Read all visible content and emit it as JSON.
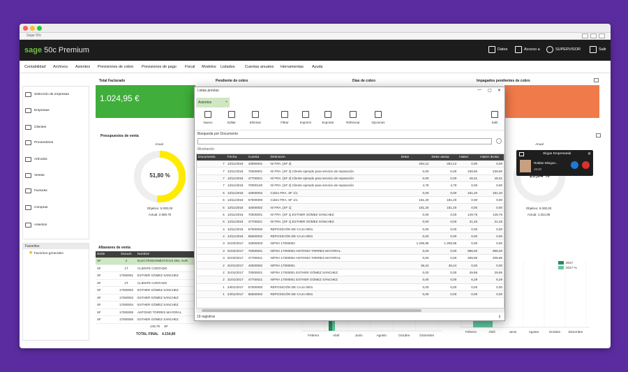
{
  "window": {
    "title": "Sage 50c"
  },
  "header": {
    "brand": "sage",
    "product": "50c Premium",
    "items": [
      {
        "icon": "database-icon",
        "label": "Datos"
      },
      {
        "icon": "access-icon",
        "label": "Acceso a"
      },
      {
        "icon": "user-icon",
        "label": "SUPERVISOR"
      },
      {
        "icon": "exit-icon",
        "label": "Salir"
      }
    ]
  },
  "menu": [
    "Contabilidad",
    "Archivos",
    "Asientos",
    "Previsiones de cobro",
    "Previsiones de pago",
    "Fiscal",
    "Modelos",
    "Listados",
    "Cuentas anuales",
    "Herramientas",
    "Ayuda"
  ],
  "sidebar": {
    "items": [
      {
        "label": "Selección de empresas",
        "icon": "company-select-icon"
      },
      {
        "label": "Empresas",
        "icon": "building-icon"
      },
      {
        "label": "Clientes",
        "icon": "clients-icon"
      },
      {
        "label": "Proveedores",
        "icon": "suppliers-icon"
      },
      {
        "label": "Artículos",
        "icon": "box-icon"
      },
      {
        "label": "Ventas",
        "icon": "sales-icon"
      },
      {
        "label": "Facturas",
        "icon": "invoice-icon"
      },
      {
        "label": "Compras",
        "icon": "cart-icon"
      },
      {
        "label": "Asientos",
        "icon": "ledger-icon"
      }
    ]
  },
  "favorites": {
    "title": "Favoritos",
    "items": [
      "Favoritos generales"
    ]
  },
  "kpis": [
    {
      "label": "Total Facturado",
      "value": "1.024,95 €",
      "color": "#3fae3a"
    },
    {
      "label": "Pendiente de cobro",
      "value": ""
    },
    {
      "label": "Días de cobro",
      "value": ""
    },
    {
      "label": "Impagados pendientes de cobro",
      "value": "",
      "color": "#f07a4a"
    }
  ],
  "presupuestos": {
    "title": "Presupuestos de venta",
    "left": {
      "period": "Anual",
      "percent": "51,80 %",
      "fraction": 0.518,
      "objetivo": "Objetivo: 5.000,00",
      "actual": "Actual: 2.589,75",
      "color": "#ffeb00"
    },
    "right": {
      "period": "Anual",
      "percent": "19,34 %",
      "fraction": 0.1934,
      "objetivo": "Objetivo: 5.000,00",
      "actual": "Actual: 1.024,95"
    }
  },
  "albaranes": {
    "title": "Albaranes de venta",
    "columns": [
      "Serie",
      "Docum",
      "Nombre"
    ],
    "rows": [
      [
        "SF",
        "2",
        "ELECTRODOMÉSTICOS DEL SUR"
      ],
      [
        "SF",
        "1T",
        "CLIENTE CONTADO"
      ],
      [
        "SF",
        "17000001",
        "ESTHER GÓMEZ SÁNCHEZ"
      ],
      [
        "SF",
        "2T",
        "CLIENTE CONTADO"
      ],
      [
        "SF",
        "17000002",
        "ESTHER GÓMEZ SÁNCHEZ"
      ],
      [
        "SF",
        "17000003",
        "ESTHER GÓMEZ SÁNCHEZ"
      ],
      [
        "SF",
        "17000004",
        "ESTHER GÓMEZ SÁNCHEZ"
      ],
      [
        "SF",
        "17000005",
        "ANTONIO TORRES MAYORAL"
      ],
      [
        "SF",
        "17000006",
        "ESTHER GÓMEZ SÁNCHEZ"
      ]
    ],
    "last_amount": "149,75",
    "last_currency": "SF",
    "total_label": "TOTAL FINAL",
    "total_value": "4.154,80"
  },
  "modal": {
    "title": "Listas previas",
    "selector": "Asientos",
    "toolbar": [
      "Nuevo",
      "Editar",
      "Eliminar",
      "Filtrar",
      "Imprimir",
      "Exportar",
      "Refrescar",
      "Opciones",
      "Salir"
    ],
    "search_label": "Búsqueda por Documento",
    "mostrando": "Mostrando:",
    "columns": [
      "Documento",
      "Fecha",
      "Cuenta",
      "Definición",
      "Debe",
      "Debe divisa",
      "Haber",
      "Haber divisa"
    ],
    "rows": [
      [
        "7",
        "13/11/2018",
        "43000001",
        "N/ FRA. [SF     2]",
        "284,12",
        "284,12",
        "0,00",
        "0,00"
      ],
      [
        "7",
        "13/11/2018",
        "70000001",
        "N/ FRA. [SF     2] Cliente ejemplo para servicio de reparación",
        "0,00",
        "0,00",
        "239,60",
        "239,60"
      ],
      [
        "7",
        "13/11/2018",
        "47700021",
        "N/ FRA. [SF     2] Cliente ejemplo para servicio de reparación",
        "0,00",
        "0,00",
        "49,31",
        "49,31"
      ],
      [
        "7",
        "13/11/2018",
        "70000100",
        "N/ FRA. [SF     2] Cliente ejemplo para servicio de reparación",
        "4,79",
        "4,79",
        "0,00",
        "0,00"
      ],
      [
        "6",
        "13/11/2018",
        "43000002",
        "Cobro FRA. SF     1/1",
        "0,00",
        "0,00",
        "181,20",
        "181,20"
      ],
      [
        "6",
        "13/11/2018",
        "57000000",
        "Cobro FRA. SF     1/1",
        "181,20",
        "181,20",
        "0,00",
        "0,00"
      ],
      [
        "5",
        "13/11/2018",
        "43000002",
        "N/ FRA. [SF     1]",
        "181,20",
        "181,20",
        "0,00",
        "0,00"
      ],
      [
        "5",
        "13/11/2018",
        "70000001",
        "N/ FRA. [SF     1] ESTHER GÓMEZ SÁNCHEZ",
        "0,00",
        "0,00",
        "149,75",
        "149,75"
      ],
      [
        "5",
        "13/11/2018",
        "47700021",
        "N/ FRA. [SF     1] ESTHER GÓMEZ SÁNCHEZ",
        "0,00",
        "0,00",
        "31,45",
        "31,45"
      ],
      [
        "4",
        "13/11/2018",
        "57000000",
        "REPOSICIÓN DE CAJA 0001",
        "0,00",
        "0,00",
        "0,00",
        "0,00"
      ],
      [
        "4",
        "13/11/2018",
        "55500002",
        "REPOSICIÓN DE CAJA 0001",
        "0,00",
        "0,00",
        "0,00",
        "0,00"
      ],
      [
        "3",
        "01/02/2017",
        "43000003",
        "N/FRA 17000002",
        "1.205,95",
        "1.205,95",
        "0,00",
        "0,00"
      ],
      [
        "3",
        "01/02/2017",
        "70000001",
        "N/FRA 17000002 ANTONIO TORRES MAYORAL",
        "0,00",
        "0,00",
        "996,00",
        "996,00"
      ],
      [
        "3",
        "01/02/2017",
        "47700021",
        "N/FRA 17000002 ANTONIO TORRES MAYORAL",
        "0,00",
        "0,00",
        "208,95",
        "208,95"
      ],
      [
        "2",
        "31/01/2017",
        "43000002",
        "N/FRA 17000001",
        "36,24",
        "36,24",
        "0,00",
        "0,00"
      ],
      [
        "2",
        "31/01/2017",
        "70000001",
        "N/FRA 17000001 ESTHER GÓMEZ SÁNCHEZ",
        "0,00",
        "0,00",
        "29,95",
        "29,95"
      ],
      [
        "2",
        "31/01/2017",
        "47700021",
        "N/FRA 17000001 ESTHER GÓMEZ SÁNCHEZ",
        "0,00",
        "0,00",
        "6,29",
        "6,29"
      ],
      [
        "1",
        "24/01/2017",
        "57000000",
        "REPOSICIÓN DE CAJA 0001",
        "0,00",
        "0,00",
        "0,00",
        "0,00"
      ],
      [
        "1",
        "24/01/2017",
        "55500002",
        "REPOSICIÓN DE CAJA 0001",
        "0,00",
        "0,00",
        "0,00",
        "0,00"
      ]
    ],
    "footer": "19 registros"
  },
  "skype": {
    "title": "Skype Empresarial",
    "name": "Roldan Mingue...",
    "time": "15:40"
  },
  "chart_data": [
    {
      "type": "bar",
      "categories": [
        "Febrero",
        "Abril",
        "Junio",
        "Agosto",
        "Octubre",
        "Diciembre"
      ],
      "series": []
    },
    {
      "type": "bar",
      "categories": [
        "Febrero",
        "Abril",
        "Junio",
        "Agosto",
        "Octubre",
        "Diciembre"
      ],
      "series": [
        {
          "name": "2017",
          "color": "#2a8a5a"
        },
        {
          "name": "2017 %",
          "color": "#5ec9a0"
        }
      ]
    }
  ]
}
